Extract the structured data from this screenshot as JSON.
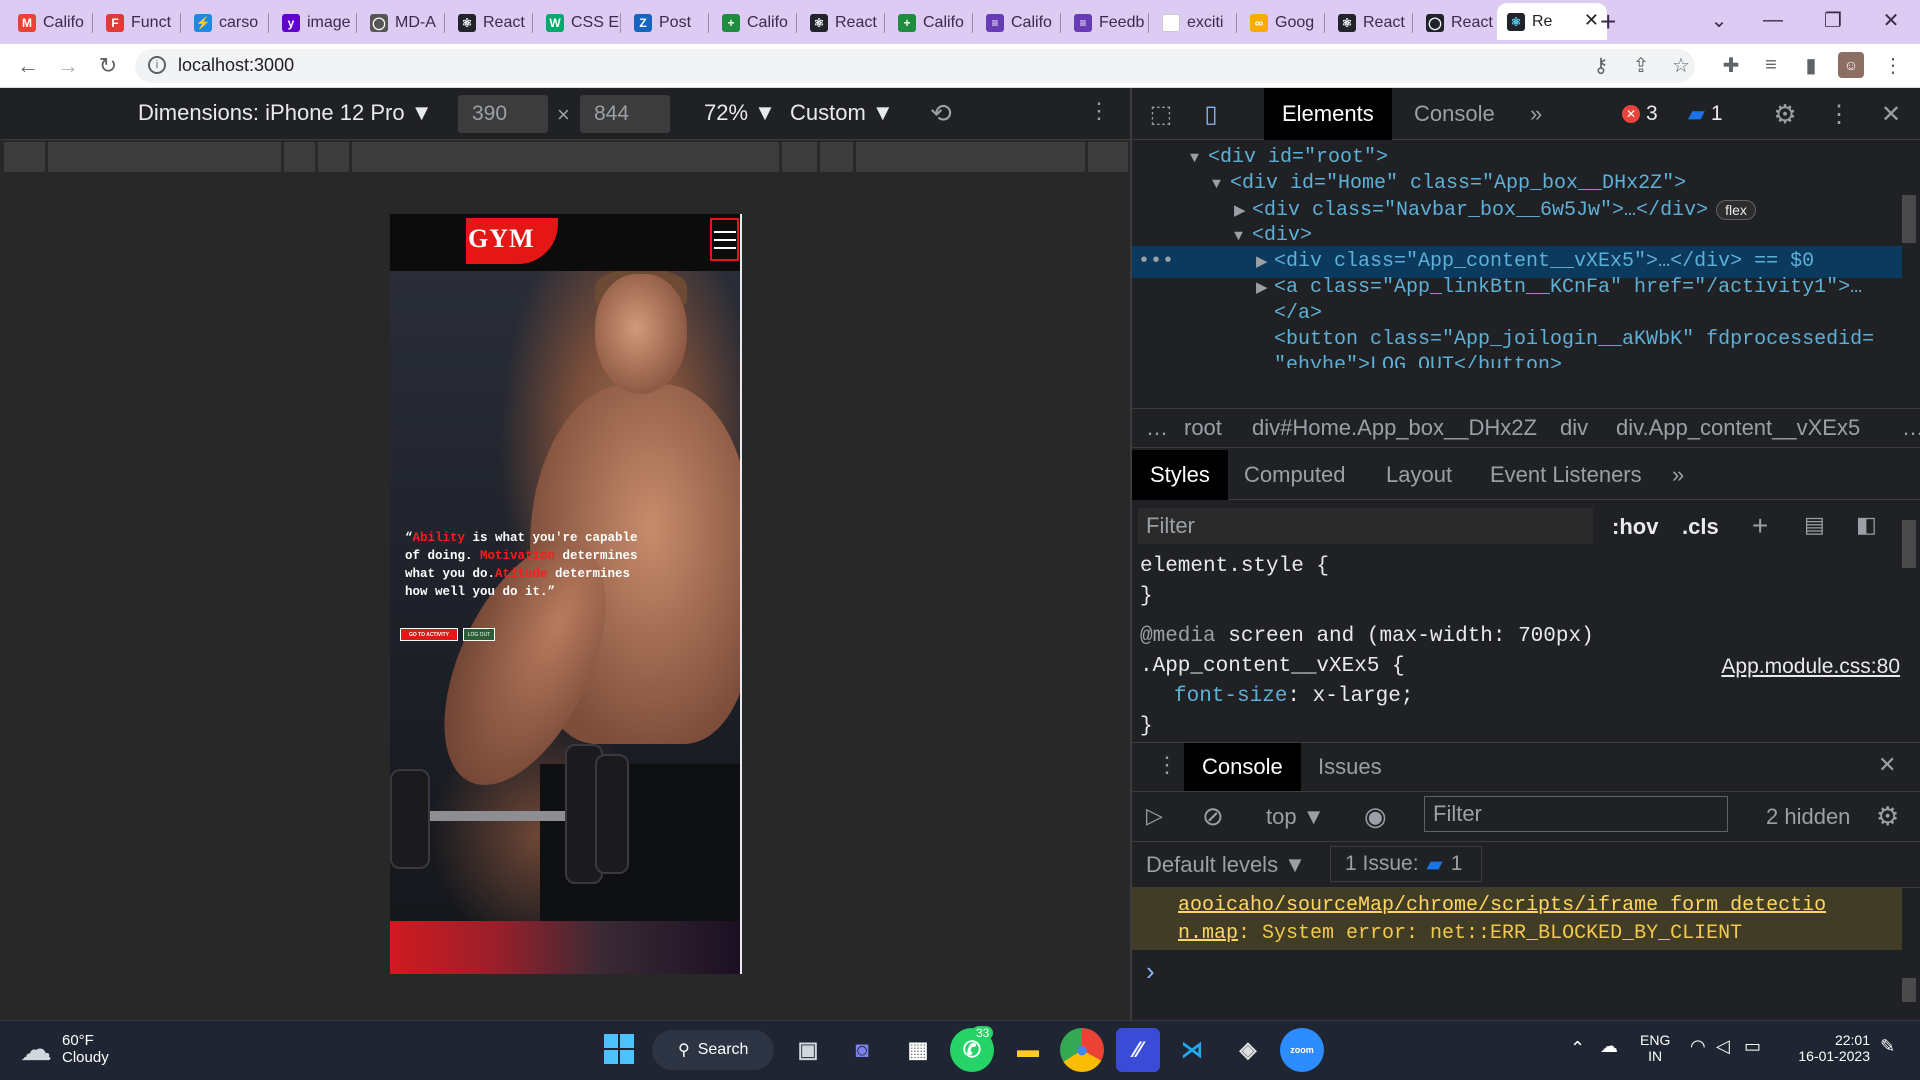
{
  "browser": {
    "tabs": [
      {
        "label": "Califo",
        "favicon": "gmail-icon",
        "color": "#ea4335",
        "glyph": "M"
      },
      {
        "label": "Funct",
        "favicon": "red-shield-icon",
        "color": "#e53935",
        "glyph": "F"
      },
      {
        "label": "carso",
        "favicon": "lightning-icon",
        "color": "#1e88e5",
        "glyph": "⚡"
      },
      {
        "label": "image",
        "favicon": "yahoo-icon",
        "color": "#6001d2",
        "glyph": "y"
      },
      {
        "label": "MD-A",
        "favicon": "github-icon",
        "color": "#555555",
        "glyph": "◯"
      },
      {
        "label": "React",
        "favicon": "react-icon",
        "color": "#20232a",
        "glyph": "⚛"
      },
      {
        "label": "CSS E",
        "favicon": "w3schools-icon",
        "color": "#04aa6d",
        "glyph": "W"
      },
      {
        "label": "Post",
        "favicon": "z-icon",
        "color": "#1565c0",
        "glyph": "Z"
      },
      {
        "label": "Califo",
        "favicon": "plus-green-icon",
        "color": "#1e8e3e",
        "glyph": "+"
      },
      {
        "label": "React",
        "favicon": "react-icon",
        "color": "#20232a",
        "glyph": "⚛"
      },
      {
        "label": "Califo",
        "favicon": "plus-green-icon",
        "color": "#1e8e3e",
        "glyph": "+"
      },
      {
        "label": "Califo",
        "favicon": "form-icon",
        "color": "#673ab7",
        "glyph": "≡"
      },
      {
        "label": "Feedb",
        "favicon": "form-icon",
        "color": "#673ab7",
        "glyph": "≡"
      },
      {
        "label": "exciti",
        "favicon": "blank-page-icon",
        "color": "#ffffff",
        "glyph": ""
      },
      {
        "label": "Goog",
        "favicon": "google-colab-icon",
        "color": "#f9ab00",
        "glyph": "∞"
      },
      {
        "label": "React",
        "favicon": "react-icon",
        "color": "#20232a",
        "glyph": "⚛"
      },
      {
        "label": "React",
        "favicon": "github-icon",
        "color": "#20232a",
        "glyph": "◯"
      }
    ],
    "active_tab": {
      "label": "Re",
      "favicon": "react-icon",
      "close": "✕"
    },
    "new_tab": "+",
    "url": "localhost:3000"
  },
  "device_toolbar": {
    "dimensions_label": "Dimensions: iPhone 12 Pro ▼",
    "width": "390",
    "times": "×",
    "height": "844",
    "zoom": "72% ▼",
    "throttle": "Custom ▼"
  },
  "app": {
    "logo_text": "GYM",
    "quote_parts": [
      {
        "text": "“",
        "red": false
      },
      {
        "text": "Ability",
        "red": true
      },
      {
        "text": " is what you're capable of doing. ",
        "red": false
      },
      {
        "text": "Motivation",
        "red": true
      },
      {
        "text": " determines what you do.",
        "red": false
      },
      {
        "text": "Atitude",
        "red": true
      },
      {
        "text": " determines how well you do it.”",
        "red": false
      }
    ],
    "activity_button": "GO TO ACTIVITY",
    "logout_button": "LOG OUT"
  },
  "devtools": {
    "tabs": [
      "Elements",
      "Console"
    ],
    "more": "»",
    "errors_count": "3",
    "messages_count": "1",
    "dom_lines": [
      {
        "indent": 0,
        "arrow": "▼",
        "html": "<div id=\"root\">"
      },
      {
        "indent": 1,
        "arrow": "▼",
        "html": "<div id=\"Home\" class=\"App_box__DHx2Z\">"
      },
      {
        "indent": 2,
        "arrow": "▶",
        "html": "<div class=\"Navbar_box__6w5Jw\">…</div>"
      },
      {
        "indent": 2,
        "arrow": "▼",
        "html": "<div>"
      },
      {
        "indent": 3,
        "arrow": "▶",
        "html": "<div class=\"App_content__vXEx5\">…</div> == $0"
      },
      {
        "indent": 3,
        "arrow": "▶",
        "html": "<a class=\"App_linkBtn__KCnFa\" href=\"/activity1\">…"
      },
      {
        "indent": 3,
        "arrow": "",
        "html": "</a>"
      },
      {
        "indent": 3,
        "arrow": "",
        "html": "<button class=\"App_joilogin__aKWbK\" fdprocessedid="
      }
    ],
    "dom_truncated_line": "\"ehyhe\">LOG OUT</button>",
    "flex_badge": "flex",
    "breadcrumbs": [
      "…",
      "root",
      "div#Home.App_box__DHx2Z",
      "div",
      "div.App_content__vXEx5",
      "…"
    ],
    "style_tabs": [
      "Styles",
      "Computed",
      "Layout",
      "Event Listeners"
    ],
    "filter_placeholder": "Filter",
    "hov": ":hov",
    "cls": ".cls",
    "element_style": "element.style {",
    "close_brace": "}",
    "media_at": "@media",
    "media_query": "screen and (max-width: 700px)",
    "selector": ".App_content__vXEx5 {",
    "source_link": "App.module.css:80",
    "property": "font-size",
    "property_value": "x-large;",
    "console_tabs": [
      "Console",
      "Issues"
    ],
    "context": "top ▼",
    "console_filter": "Filter",
    "hidden": "2 hidden",
    "default_levels": "Default levels ▼",
    "issues": "1 Issue:",
    "issues_count": "1",
    "warn_line1": "aooicaho/sourceMap/chrome/scripts/iframe_form_detectio",
    "warn_line2_link": "n.map",
    "warn_line2_rest": ": System error: net::ERR_BLOCKED_BY_CLIENT",
    "prompt": "›"
  },
  "taskbar": {
    "weather_temp": "60°F",
    "weather_desc": "Cloudy",
    "search": "Search",
    "whatsapp_badge": "33",
    "lang": "ENG",
    "region": "IN",
    "time": "22:01",
    "date": "16-01-2023"
  }
}
